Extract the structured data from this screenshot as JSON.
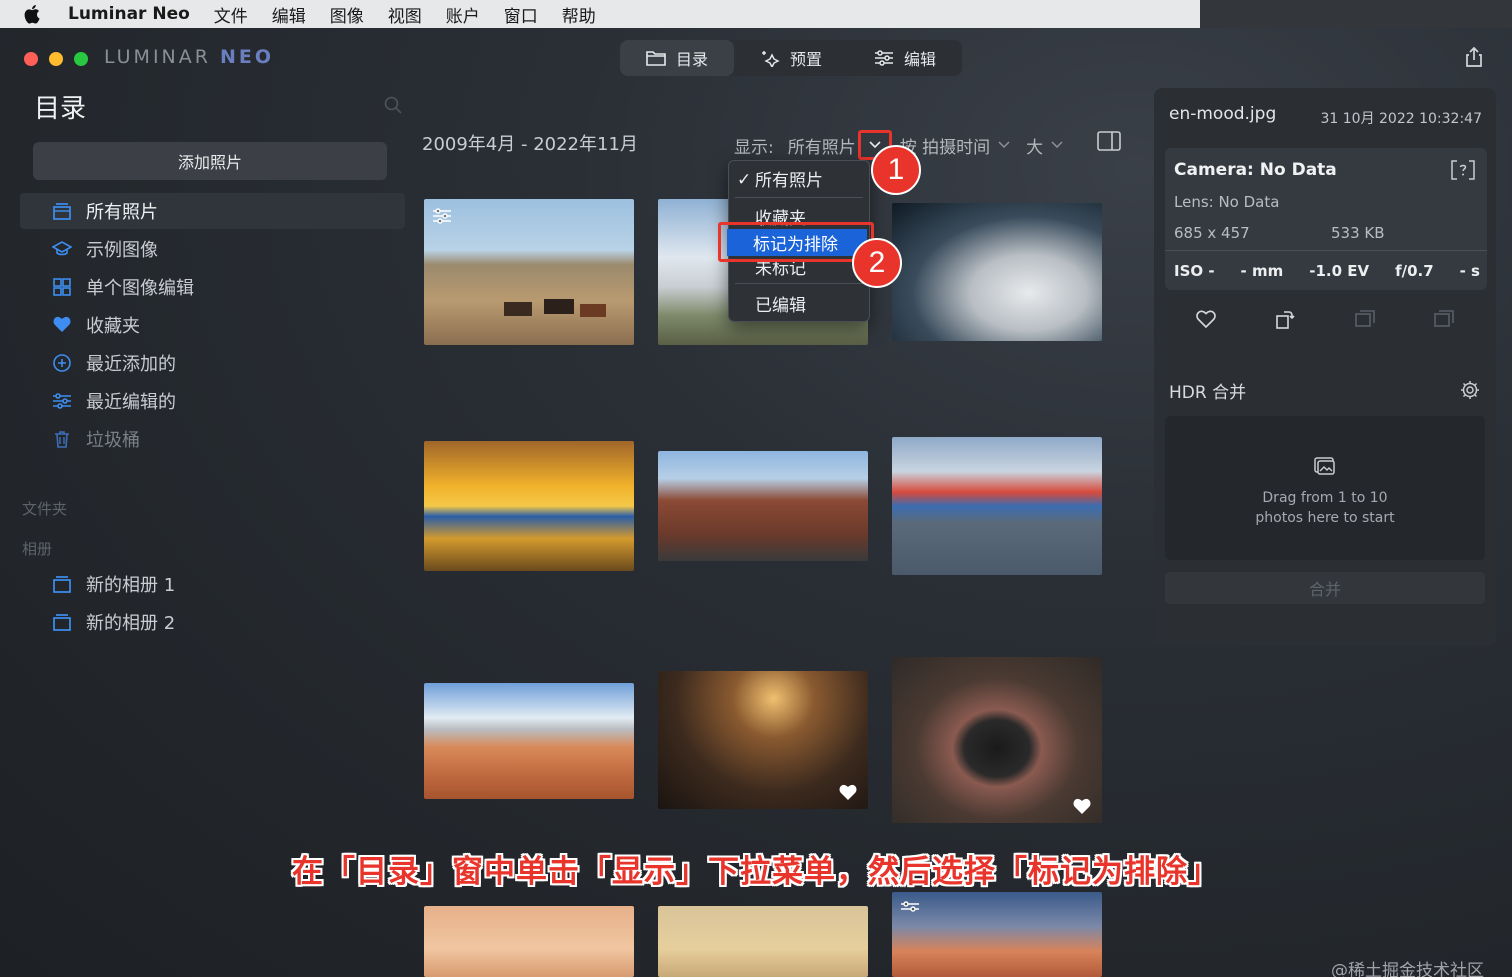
{
  "menubar": {
    "app_name": "Luminar Neo",
    "items": [
      "文件",
      "编辑",
      "图像",
      "视图",
      "账户",
      "窗口",
      "帮助"
    ]
  },
  "window": {
    "brand_main": "LUMINAR",
    "brand_accent": "NEO",
    "tabs": [
      {
        "label": "目录",
        "icon": "folder-icon",
        "active": true
      },
      {
        "label": "预置",
        "icon": "sparkle-icon",
        "active": false
      },
      {
        "label": "编辑",
        "icon": "sliders-icon",
        "active": false
      }
    ]
  },
  "sidebar": {
    "title": "目录",
    "add_button": "添加照片",
    "items": [
      {
        "label": "所有照片",
        "icon": "all-photos-icon"
      },
      {
        "label": "示例图像",
        "icon": "graduation-cap-icon"
      },
      {
        "label": "单个图像编辑",
        "icon": "grid-icon"
      },
      {
        "label": "收藏夹",
        "icon": "heart-icon"
      },
      {
        "label": "最近添加的",
        "icon": "plus-circle-icon"
      },
      {
        "label": "最近编辑的",
        "icon": "sliders-icon"
      },
      {
        "label": "垃圾桶",
        "icon": "trash-icon"
      }
    ],
    "folders_label": "文件夹",
    "albums_label": "相册",
    "albums": [
      {
        "label": "新的相册 1",
        "icon": "album-icon"
      },
      {
        "label": "新的相册 2",
        "icon": "album-icon"
      }
    ]
  },
  "main": {
    "date_range": "2009年4月 - 2022年11月",
    "filter_label": "显示:",
    "filter_value": "所有照片",
    "sort_label": "按 拍摄时间",
    "size_label": "大"
  },
  "dropdown": {
    "items": [
      "所有照片",
      "收藏夹",
      "标记为排除",
      "未标记",
      "已编辑"
    ],
    "checked": "所有照片",
    "highlighted": "标记为排除"
  },
  "steps": [
    "1",
    "2"
  ],
  "info": {
    "filename": "en-mood.jpg",
    "datetime": "31 10月 2022 10:32:47",
    "camera": "Camera: No Data",
    "lens": "Lens: No Data",
    "dimensions": "685 x 457",
    "filesize": "533 KB",
    "exif": [
      "ISO -",
      "- mm",
      "-1.0 EV",
      "f/0.7",
      "- s"
    ]
  },
  "hdr": {
    "title": "HDR 合并",
    "drop_line1": "Drag from 1 to 10",
    "drop_line2": "photos here to start",
    "merge_button": "合并"
  },
  "caption": "在「目录」窗中单击「显示」下拉菜单，然后选择「标记为排除」",
  "watermark": "@稀土掘金技术社区",
  "colors": {
    "accent_red": "#e8342b",
    "highlight_blue": "#1a63d8",
    "sidebar_icon_blue": "#3d8ef0"
  }
}
